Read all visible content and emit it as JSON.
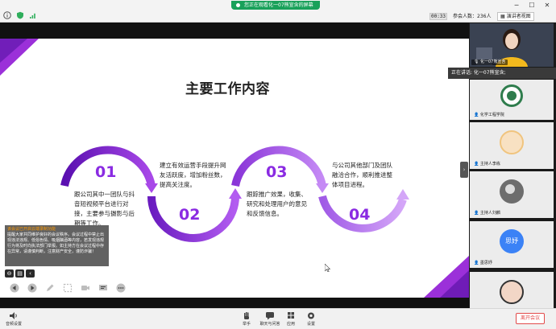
{
  "topbar": {
    "share_banner": "您正在观看化一07熊宣含的屏幕",
    "timer": "00:33",
    "participants": "参会人数：236人",
    "view_mode": "演讲者视图"
  },
  "slide": {
    "title": "主要工作内容",
    "steps": [
      {
        "number": "01",
        "text": "跟公司其中一团队与抖音短视频平台进行对接，主要参与摄影与后期等工作。"
      },
      {
        "number": "02",
        "text": "建立有效运营手段提升网友活跃度，增加粉丝数，提高关注度。"
      },
      {
        "number": "03",
        "text": "跟踪推广效果，收集、研究和处理用户的意见和反馈信息。"
      },
      {
        "number": "04",
        "text": "与公司其他部门及团队融洽合作，顺利推进整体项目进程。"
      }
    ]
  },
  "subtitle_overlay": {
    "title": "该会议已开启云端录制功能",
    "body": "提醒大家共同维护良好的会议秩序。会议过程中禁止出现违法违规、低俗色情、吸烟酗酒等内容，若发现违规行为将及时向执法部门举报。如主持方在会议过程中存在异常，请谨慎判断，注意财产安全，谨防诈骗！"
  },
  "participants_panel": {
    "speaking_now": "正在讲话: 化一07熊宣含;",
    "tiles": [
      {
        "name": "化一07熊宣含"
      },
      {
        "name": "化学工程学院"
      },
      {
        "name": "主持人李栋"
      },
      {
        "name": "主持人刘麟"
      },
      {
        "name": "墨思妤",
        "avatar_text": "思妤"
      },
      {
        "name": ""
      }
    ]
  },
  "bottombar": {
    "audio_settings": "音频设置",
    "raise_hand": "举手",
    "chat": "聊天与问答",
    "apps": "应用",
    "settings": "设置",
    "leave": "离开会议"
  },
  "colors": {
    "accent_purple": "#8a2be2",
    "share_green": "#19a15a",
    "leave_red": "#e24b4b"
  }
}
